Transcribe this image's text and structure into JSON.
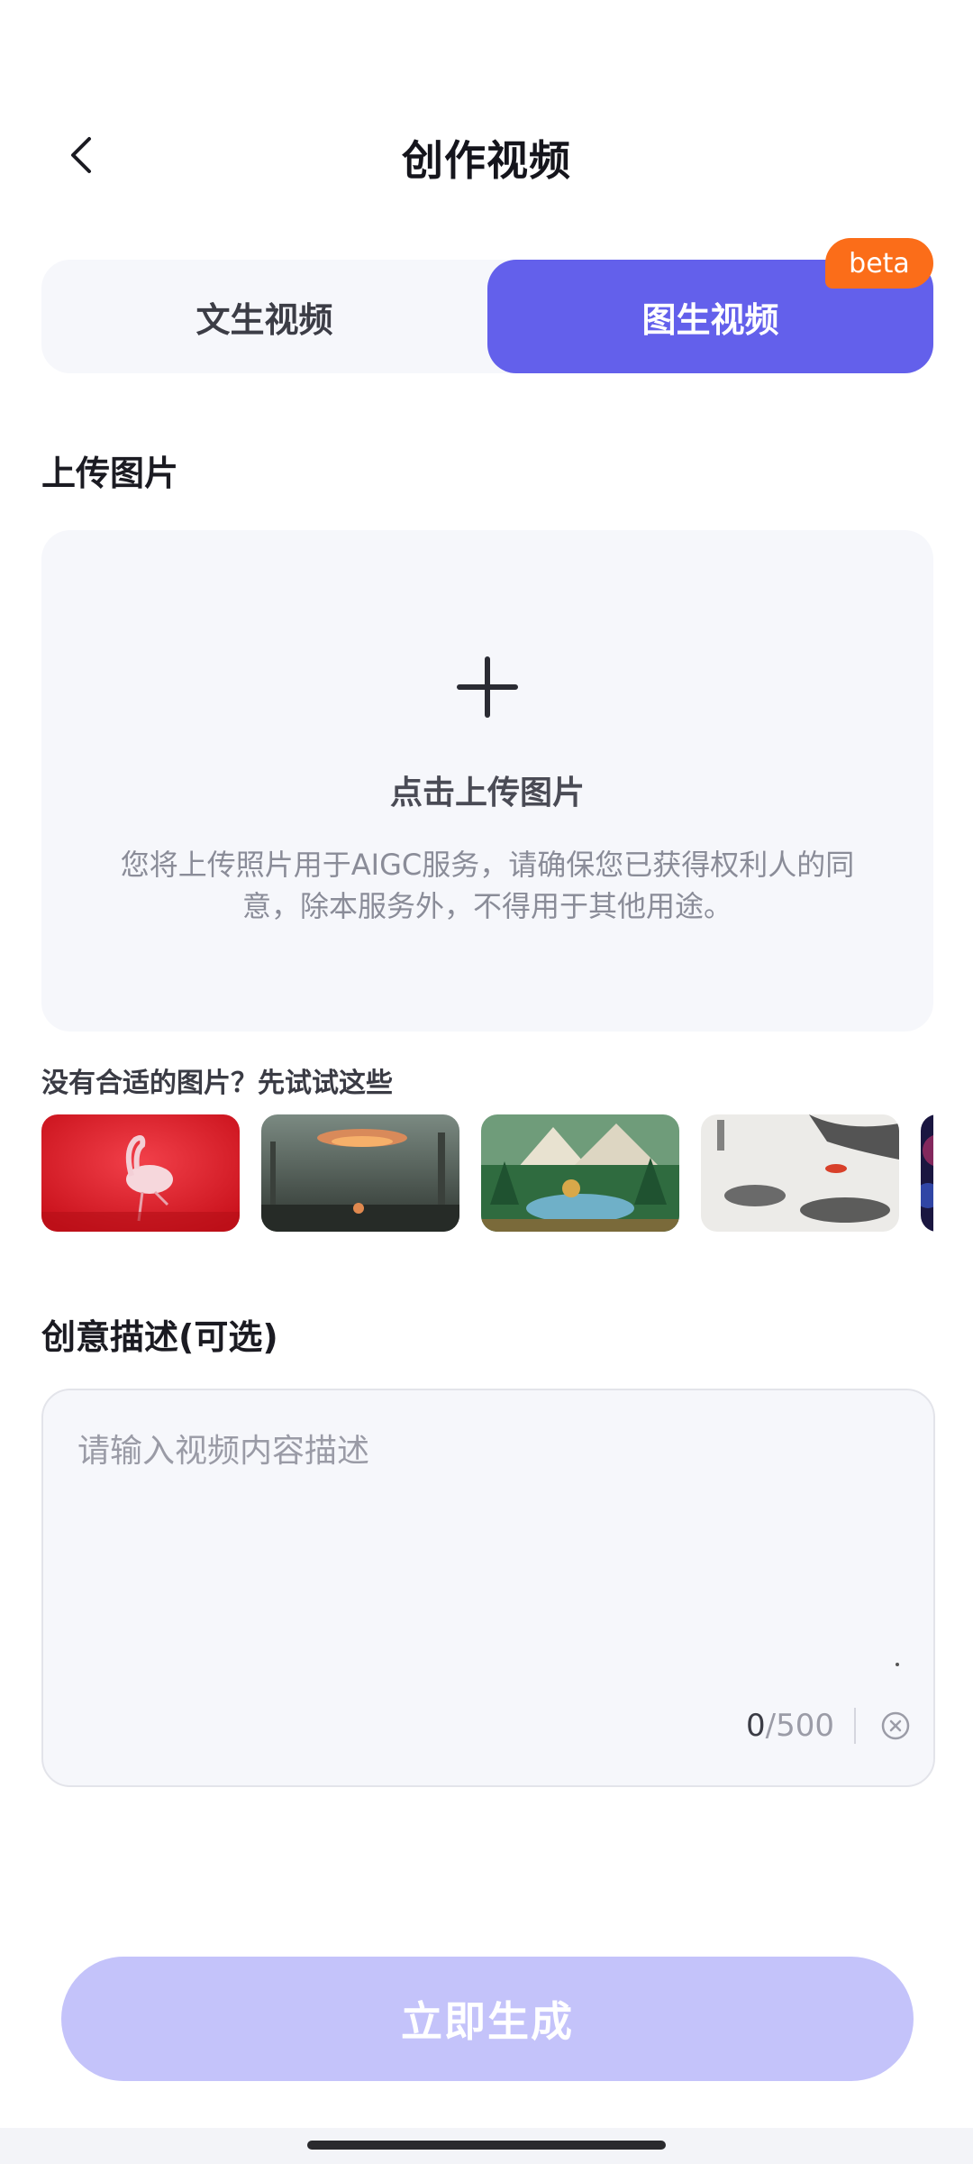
{
  "header": {
    "title": "创作视频",
    "back_icon": "chevron-left-icon"
  },
  "tabs": [
    {
      "label": "文生视频",
      "active": false
    },
    {
      "label": "图生视频",
      "active": true,
      "badge": "beta"
    }
  ],
  "upload": {
    "section_title": "上传图片",
    "icon": "plus-icon",
    "label": "点击上传图片",
    "notice": "您将上传照片用于AIGC服务，请确保您已获得权利人的同意，除本服务外，不得用于其他用途。"
  },
  "samples": {
    "hint": "没有合适的图片？先试试这些",
    "items": [
      "flamingo-thumb",
      "ufo-thumb",
      "clay-forest-thumb",
      "ink-painting-thumb",
      "galaxy-thumb"
    ]
  },
  "description": {
    "section_title": "创意描述(可选)",
    "placeholder": "请输入视频内容描述",
    "count": "0",
    "max": "/500",
    "clear_icon": "clear-circle-icon"
  },
  "generate_button": {
    "label": "立即生成"
  },
  "colors": {
    "accent": "#6360eb",
    "accent_disabled": "#c4c3fa",
    "badge": "#fb6d19",
    "panel_bg": "#f6f7fb"
  }
}
